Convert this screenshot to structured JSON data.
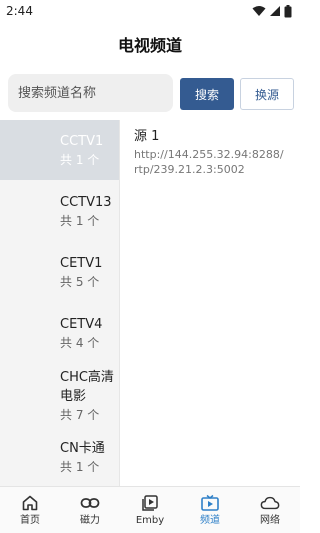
{
  "status_bar": {
    "time": "2:44"
  },
  "header": {
    "title": "电视频道"
  },
  "search": {
    "placeholder": "搜索频道名称",
    "search_label": "搜索",
    "switch_label": "换源"
  },
  "channels": [
    {
      "name": "CCTV1",
      "count": "共 1 个"
    },
    {
      "name": "CCTV13",
      "count": "共 1 个"
    },
    {
      "name": "CETV1",
      "count": "共 5 个"
    },
    {
      "name": "CETV4",
      "count": "共 4 个"
    },
    {
      "name": "CHC高清电影",
      "count": "共 7 个"
    },
    {
      "name": "CN卡通",
      "count": "共 1 个"
    }
  ],
  "source": {
    "title": "源 1",
    "url": "http://144.255.32.94:8288/rtp/239.21.2.3:5002"
  },
  "nav": [
    {
      "label": "首页",
      "icon": "home-icon"
    },
    {
      "label": "磁力",
      "icon": "link-icon"
    },
    {
      "label": "Emby",
      "icon": "play-icon"
    },
    {
      "label": "频道",
      "icon": "tv-icon"
    },
    {
      "label": "网络",
      "icon": "cloud-icon"
    }
  ],
  "colors": {
    "accent": "#345b91",
    "nav_active": "#2f80c8",
    "list_active": "#d9dde2"
  }
}
